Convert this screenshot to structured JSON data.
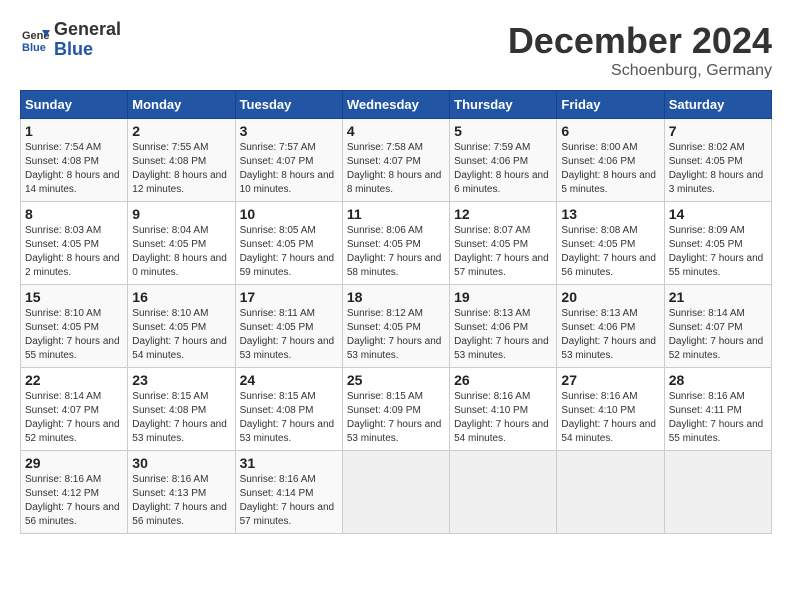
{
  "header": {
    "logo_line1": "General",
    "logo_line2": "Blue",
    "month": "December 2024",
    "location": "Schoenburg, Germany"
  },
  "weekdays": [
    "Sunday",
    "Monday",
    "Tuesday",
    "Wednesday",
    "Thursday",
    "Friday",
    "Saturday"
  ],
  "weeks": [
    [
      {
        "day": "1",
        "sunrise": "7:54 AM",
        "sunset": "4:08 PM",
        "daylight": "8 hours and 14 minutes."
      },
      {
        "day": "2",
        "sunrise": "7:55 AM",
        "sunset": "4:08 PM",
        "daylight": "8 hours and 12 minutes."
      },
      {
        "day": "3",
        "sunrise": "7:57 AM",
        "sunset": "4:07 PM",
        "daylight": "8 hours and 10 minutes."
      },
      {
        "day": "4",
        "sunrise": "7:58 AM",
        "sunset": "4:07 PM",
        "daylight": "8 hours and 8 minutes."
      },
      {
        "day": "5",
        "sunrise": "7:59 AM",
        "sunset": "4:06 PM",
        "daylight": "8 hours and 6 minutes."
      },
      {
        "day": "6",
        "sunrise": "8:00 AM",
        "sunset": "4:06 PM",
        "daylight": "8 hours and 5 minutes."
      },
      {
        "day": "7",
        "sunrise": "8:02 AM",
        "sunset": "4:05 PM",
        "daylight": "8 hours and 3 minutes."
      }
    ],
    [
      {
        "day": "8",
        "sunrise": "8:03 AM",
        "sunset": "4:05 PM",
        "daylight": "8 hours and 2 minutes."
      },
      {
        "day": "9",
        "sunrise": "8:04 AM",
        "sunset": "4:05 PM",
        "daylight": "8 hours and 0 minutes."
      },
      {
        "day": "10",
        "sunrise": "8:05 AM",
        "sunset": "4:05 PM",
        "daylight": "7 hours and 59 minutes."
      },
      {
        "day": "11",
        "sunrise": "8:06 AM",
        "sunset": "4:05 PM",
        "daylight": "7 hours and 58 minutes."
      },
      {
        "day": "12",
        "sunrise": "8:07 AM",
        "sunset": "4:05 PM",
        "daylight": "7 hours and 57 minutes."
      },
      {
        "day": "13",
        "sunrise": "8:08 AM",
        "sunset": "4:05 PM",
        "daylight": "7 hours and 56 minutes."
      },
      {
        "day": "14",
        "sunrise": "8:09 AM",
        "sunset": "4:05 PM",
        "daylight": "7 hours and 55 minutes."
      }
    ],
    [
      {
        "day": "15",
        "sunrise": "8:10 AM",
        "sunset": "4:05 PM",
        "daylight": "7 hours and 55 minutes."
      },
      {
        "day": "16",
        "sunrise": "8:10 AM",
        "sunset": "4:05 PM",
        "daylight": "7 hours and 54 minutes."
      },
      {
        "day": "17",
        "sunrise": "8:11 AM",
        "sunset": "4:05 PM",
        "daylight": "7 hours and 53 minutes."
      },
      {
        "day": "18",
        "sunrise": "8:12 AM",
        "sunset": "4:05 PM",
        "daylight": "7 hours and 53 minutes."
      },
      {
        "day": "19",
        "sunrise": "8:13 AM",
        "sunset": "4:06 PM",
        "daylight": "7 hours and 53 minutes."
      },
      {
        "day": "20",
        "sunrise": "8:13 AM",
        "sunset": "4:06 PM",
        "daylight": "7 hours and 53 minutes."
      },
      {
        "day": "21",
        "sunrise": "8:14 AM",
        "sunset": "4:07 PM",
        "daylight": "7 hours and 52 minutes."
      }
    ],
    [
      {
        "day": "22",
        "sunrise": "8:14 AM",
        "sunset": "4:07 PM",
        "daylight": "7 hours and 52 minutes."
      },
      {
        "day": "23",
        "sunrise": "8:15 AM",
        "sunset": "4:08 PM",
        "daylight": "7 hours and 53 minutes."
      },
      {
        "day": "24",
        "sunrise": "8:15 AM",
        "sunset": "4:08 PM",
        "daylight": "7 hours and 53 minutes."
      },
      {
        "day": "25",
        "sunrise": "8:15 AM",
        "sunset": "4:09 PM",
        "daylight": "7 hours and 53 minutes."
      },
      {
        "day": "26",
        "sunrise": "8:16 AM",
        "sunset": "4:10 PM",
        "daylight": "7 hours and 54 minutes."
      },
      {
        "day": "27",
        "sunrise": "8:16 AM",
        "sunset": "4:10 PM",
        "daylight": "7 hours and 54 minutes."
      },
      {
        "day": "28",
        "sunrise": "8:16 AM",
        "sunset": "4:11 PM",
        "daylight": "7 hours and 55 minutes."
      }
    ],
    [
      {
        "day": "29",
        "sunrise": "8:16 AM",
        "sunset": "4:12 PM",
        "daylight": "7 hours and 56 minutes."
      },
      {
        "day": "30",
        "sunrise": "8:16 AM",
        "sunset": "4:13 PM",
        "daylight": "7 hours and 56 minutes."
      },
      {
        "day": "31",
        "sunrise": "8:16 AM",
        "sunset": "4:14 PM",
        "daylight": "7 hours and 57 minutes."
      },
      null,
      null,
      null,
      null
    ]
  ]
}
